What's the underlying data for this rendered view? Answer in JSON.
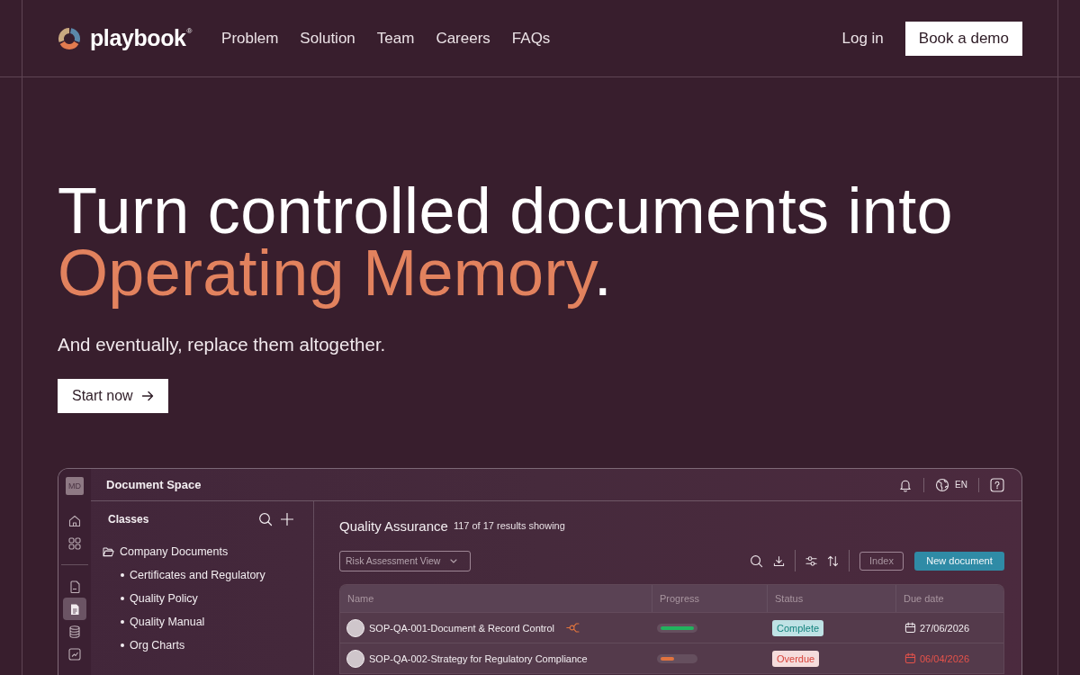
{
  "nav": {
    "logo": "playbook$^{®}$",
    "links": [
      {
        "label": "Problem"
      },
      {
        "label": "Solution"
      },
      {
        "label": "Team"
      },
      {
        "label": "Careers"
      },
      {
        "label": "FAQs"
      }
    ],
    "login": "Log in",
    "cta": "Book a demo"
  },
  "hero": {
    "title_start": "Turn controlled documents into",
    "title_highlight": "Operating Memory",
    "title_end": ".",
    "subtitle": "And eventually, replace them altogether.",
    "button": "Start now"
  },
  "app": {
    "rail": {
      "avatar": "MD",
      "groups": [
        {
          "items": [
            {
              "selected": false
            },
            {
              "selected": false
            }
          ]
        },
        {
          "items": [
            {
              "selected": false
            },
            {
              "selected": true
            },
            {
              "selected": false
            },
            {
              "selected": false
            }
          ]
        }
      ]
    },
    "title": "Document Space",
    "language": "EN",
    "classes": {
      "title": "Classes",
      "tree": [
        {
          "label": "Company Documents",
          "expanded": true,
          "children": [
            {
              "label": "Certificates and Regulatory"
            },
            {
              "label": "Quality Policy"
            },
            {
              "label": "Quality Manual"
            },
            {
              "label": "Org Charts"
            }
          ]
        }
      ]
    },
    "content": {
      "title": "Quality Assurance",
      "count": "117 of 17 results showing",
      "view": "Risk Assessment View",
      "index_button": "Index",
      "new_button": "New document",
      "table": {
        "columns": [
          "Name",
          "Progress",
          "Status",
          "Due date"
        ],
        "rows": [
          {
            "name": "SOP-QA-001-Document & Record Control",
            "linked": true,
            "level": 1,
            "status": {
              "label": "Complete",
              "kind": "complete"
            },
            "due": "27/06/2026"
          },
          {
            "name": "SOP-QA-002-Strategy for Regulatory Compliance",
            "linked": false,
            "level": 0.4,
            "status": {
              "label": "Overdue",
              "kind": "overdue"
            },
            "due": "06/04/2026"
          }
        ]
      }
    }
  }
}
